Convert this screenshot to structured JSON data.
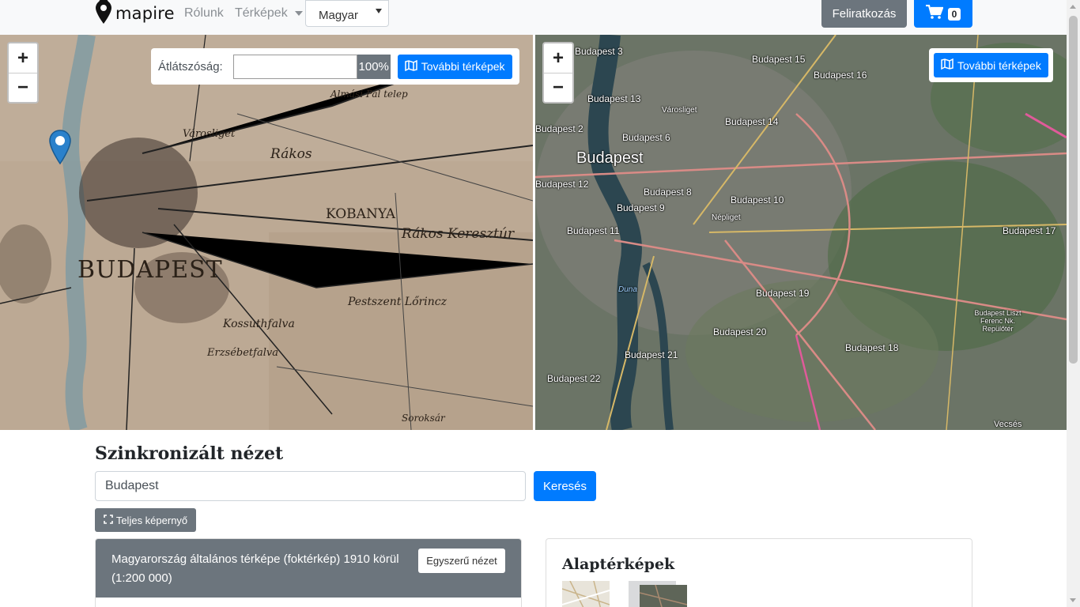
{
  "nav": {
    "brand": "mapire",
    "about": "Rólunk",
    "maps": "Térképek",
    "language": "Magyar",
    "subscribe": "Feliratkozás",
    "cart_count": "0"
  },
  "left_map": {
    "opacity_label": "Átlátszóság:",
    "opacity_value": "100%",
    "more_maps": "További térképek",
    "labels": {
      "budapest": "BUDAPEST",
      "kobanya": "KOBANYA",
      "rakos": "Rákos Keresztúr",
      "varosliget": "Városliget",
      "rakosrendezo": "Rákos",
      "pestszent": "Pestszent Lőrincz",
      "kossuthfalva": "Kossuthfalva",
      "erzsebetfalva": "Erzsébetfalva",
      "ujpest": "Almási Pál telep",
      "soroksar": "Soroksár"
    }
  },
  "right_map": {
    "more_maps": "További térképek",
    "labels": {
      "budapest": "Budapest",
      "b3": "Budapest 3",
      "b15": "Budapest 15",
      "b16": "Budapest 16",
      "b13": "Budapest 13",
      "b14": "Budapest 14",
      "b2": "Budapest 2",
      "b6": "Budapest 6",
      "b12": "Budapest 12",
      "b8": "Budapest 8",
      "b10": "Budapest 10",
      "b9": "Budapest 9",
      "b11": "Budapest 11",
      "b17": "Budapest 17",
      "b19": "Budapest 19",
      "b20": "Budapest 20",
      "b18": "Budapest 18",
      "b21": "Budapest 21",
      "b22": "Budapest 22",
      "duna": "Duna",
      "vecses": "Vecsés",
      "ferihegy": "Budapest Liszt Ferenc Nk. Repülőtér",
      "varosliget": "Városliget",
      "nepliget": "Népliget"
    }
  },
  "main": {
    "title": "Szinkronizált nézet",
    "search_value": "Budapest",
    "search_button": "Keresés",
    "fullscreen": "Teljes képernyő",
    "map_card_title": "Magyarország általános térképe (foktérkép) 1910 körül (1:200 000)",
    "simple_view": "Egyszerű nézet",
    "base_maps_title": "Alaptérképek"
  },
  "colors": {
    "primary": "#007bff",
    "secondary": "#6c757d",
    "navbar": "#f8f9fa"
  }
}
